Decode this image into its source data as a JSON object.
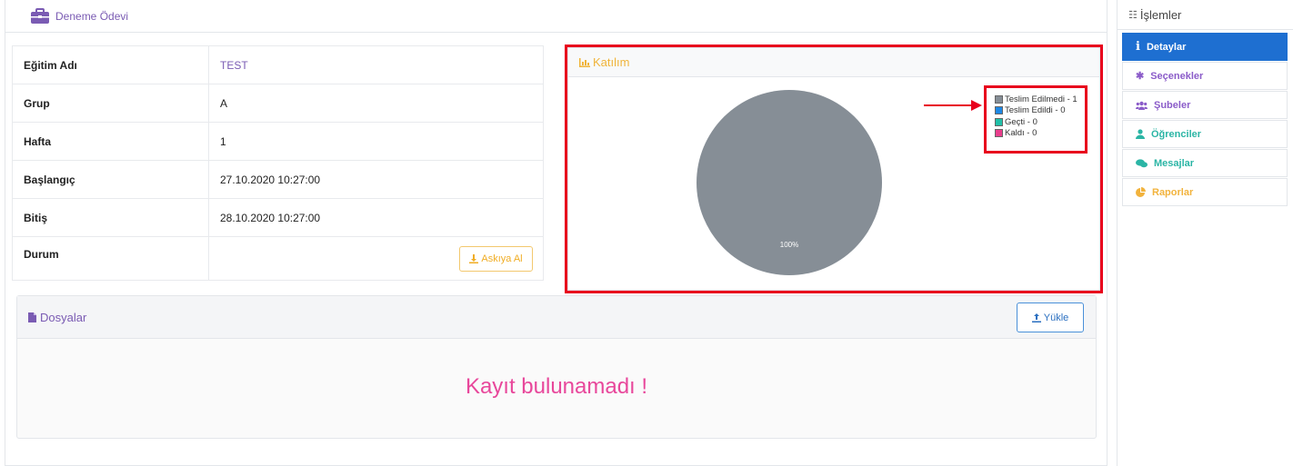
{
  "header": {
    "title": "Deneme Ödevi",
    "icon": "briefcase-icon",
    "accent": "#7a5bb3"
  },
  "info": {
    "rows": [
      {
        "label": "Eğitim Adı",
        "value": "TEST"
      },
      {
        "label": "Grup",
        "value": "A"
      },
      {
        "label": "Hafta",
        "value": "1"
      },
      {
        "label": "Başlangıç",
        "value": "27.10.2020 10:27:00"
      },
      {
        "label": "Bitiş",
        "value": "28.10.2020 10:27:00"
      },
      {
        "label": "Durum",
        "value": ""
      }
    ],
    "suspend_button": "Askıya Al"
  },
  "katilim": {
    "title": "Katılım",
    "pie_label": "100%",
    "legend": [
      {
        "label": "Teslim Edilmedi - 1",
        "color": "#868e96"
      },
      {
        "label": "Teslim Edildi - 0",
        "color": "#1e88e5"
      },
      {
        "label": "Geçti - 0",
        "color": "#20c0a8"
      },
      {
        "label": "Kaldı - 0",
        "color": "#e83e8c"
      }
    ]
  },
  "dosyalar": {
    "title": "Dosyalar",
    "upload_button": "Yükle",
    "empty_message": "Kayıt bulunamadı !"
  },
  "sidebar": {
    "title": "İşlemler",
    "items": [
      {
        "label": "Detaylar",
        "icon": "info-icon"
      },
      {
        "label": "Seçenekler",
        "icon": "gear-icon"
      },
      {
        "label": "Şubeler",
        "icon": "users-icon"
      },
      {
        "label": "Öğrenciler",
        "icon": "user-icon"
      },
      {
        "label": "Mesajlar",
        "icon": "comments-icon"
      },
      {
        "label": "Raporlar",
        "icon": "pie-chart-icon"
      }
    ]
  }
}
